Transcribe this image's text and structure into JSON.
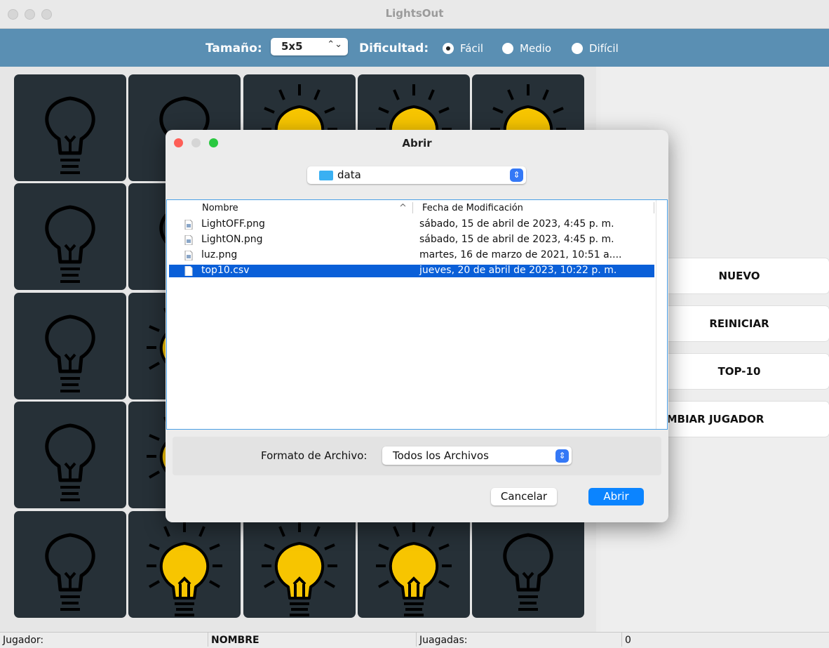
{
  "window": {
    "title": "LightsOut"
  },
  "toolbar": {
    "size_label": "Tamaño:",
    "size_value": "5x5",
    "difficulty_label": "Dificultad:",
    "difficulty_options": [
      {
        "label": "Fácil",
        "selected": true
      },
      {
        "label": "Medio",
        "selected": false
      },
      {
        "label": "Difícil",
        "selected": false
      }
    ]
  },
  "board": {
    "rows": 5,
    "cols": 5,
    "cells": [
      [
        "off",
        "off",
        "on",
        "on",
        "on"
      ],
      [
        "off",
        "off",
        "on",
        "on",
        "on"
      ],
      [
        "off",
        "on",
        "on",
        "on",
        "on"
      ],
      [
        "off",
        "on",
        "on",
        "on",
        "on"
      ],
      [
        "off",
        "on",
        "on",
        "on",
        "off"
      ]
    ]
  },
  "side_buttons": {
    "new": "NUEVO",
    "restart": "REINICIAR",
    "top10": "TOP-10",
    "change_player": "CAMBIAR JUGADOR"
  },
  "status_bar": {
    "player_label": "Jugador:",
    "player_value": "NOMBRE",
    "moves_label": "Juagadas:",
    "moves_value": "0"
  },
  "dialog": {
    "title": "Abrir",
    "location": "data",
    "columns": {
      "name": "Nombre",
      "date": "Fecha de Modificación"
    },
    "files": [
      {
        "name": "LightOFF.png",
        "date": "sábado, 15 de abril de 2023, 4:45 p. m."
      },
      {
        "name": "LightON.png",
        "date": "sábado, 15 de abril de 2023, 4:45 p. m."
      },
      {
        "name": "luz.png",
        "date": "martes, 16 de marzo de 2021, 10:51 a...."
      },
      {
        "name": "top10.csv",
        "date": "jueves, 20 de abril de 2023, 10:22 p. m.",
        "selected": true
      }
    ],
    "format_label": "Formato de Archivo:",
    "format_value": "Todos los Archivos",
    "cancel": "Cancelar",
    "open": "Abrir"
  },
  "colors": {
    "toolbar": "#5a8fb3",
    "cell_bg": "#263037",
    "bulb_on": "#f7c500",
    "selection": "#0a5fd8",
    "primary_button": "#0b84ff"
  }
}
